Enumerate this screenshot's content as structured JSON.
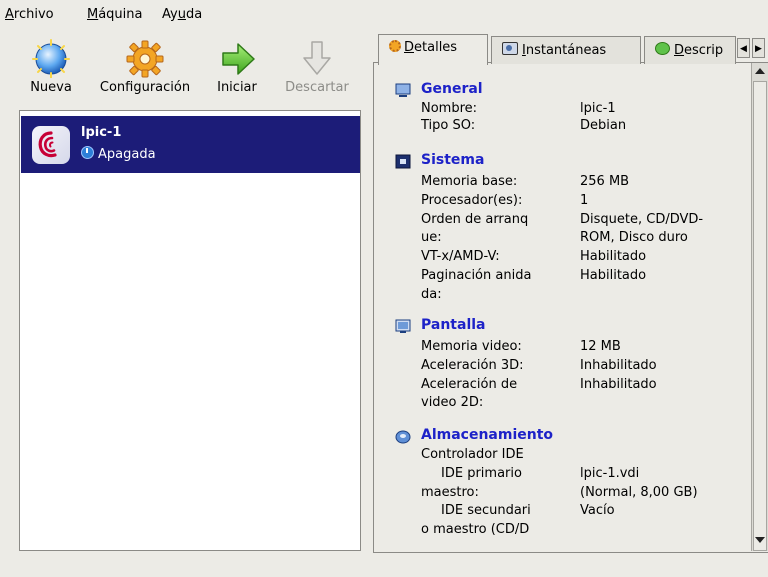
{
  "menu": {
    "archivo": {
      "u": "A",
      "rest": "rchivo"
    },
    "maquina": {
      "u": "M",
      "rest": "áquina"
    },
    "ayuda": {
      "pre": "Ay",
      "u": "u",
      "rest": "da"
    }
  },
  "toolbar": {
    "nueva": "Nueva",
    "configuracion": "Configuración",
    "iniciar": "Iniciar",
    "descartar": "Descartar"
  },
  "vm": {
    "name": "lpic-1",
    "state": "Apagada"
  },
  "tabs": {
    "detalles": {
      "u": "D",
      "rest": "etalles"
    },
    "instantaneas": {
      "u": "I",
      "rest": "nstantáneas"
    },
    "descripcion": {
      "u": "D",
      "rest": "escrip"
    }
  },
  "details": {
    "general": {
      "title": "General",
      "rows": [
        {
          "k": "Nombre:",
          "v": "lpic-1"
        },
        {
          "k": "Tipo SO:",
          "v": "Debian"
        }
      ]
    },
    "sistema": {
      "title": "Sistema",
      "rows": [
        {
          "k": "Memoria base:",
          "v": "256 MB"
        },
        {
          "k": "Procesador(es):",
          "v": "1"
        },
        {
          "k": "Orden de arranq",
          "v": "Disquete, CD/DVD-"
        },
        {
          "k": "ue:",
          "v": "ROM, Disco duro"
        },
        {
          "k": "VT-x/AMD-V:",
          "v": "Habilitado"
        },
        {
          "k": "Paginación anida",
          "v": "Habilitado"
        },
        {
          "k": "da:",
          "v": ""
        }
      ]
    },
    "pantalla": {
      "title": "Pantalla",
      "rows": [
        {
          "k": "Memoria video:",
          "v": "12 MB"
        },
        {
          "k": "Aceleración 3D:",
          "v": "Inhabilitado"
        },
        {
          "k": "Aceleración de",
          "v": "Inhabilitado"
        },
        {
          "k": "video 2D:",
          "v": ""
        }
      ]
    },
    "almacenamiento": {
      "title": "Almacenamiento",
      "rows": [
        {
          "k": "Controlador IDE",
          "v": ""
        },
        {
          "k": "IDE primario",
          "v": "lpic-1.vdi"
        },
        {
          "k": "maestro:",
          "v": "(Normal, 8,00 GB)"
        },
        {
          "k": "IDE secundari",
          "v": "Vacío"
        },
        {
          "k": "o maestro (CD/D",
          "v": ""
        }
      ]
    }
  },
  "colors": {
    "selection": "#1c1c78",
    "section_title": "#1d22c8",
    "window_bg": "#ecebe6"
  }
}
